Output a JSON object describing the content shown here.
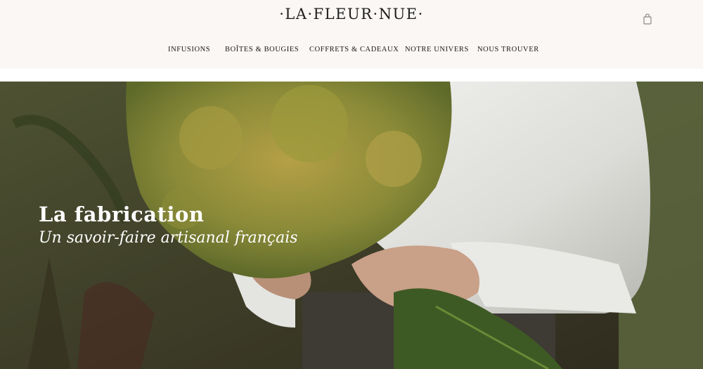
{
  "brand": {
    "logo": "·LA·FLEUR·NUE·"
  },
  "header": {
    "cart_icon": "shopping-bag-icon"
  },
  "nav": {
    "items": [
      {
        "label": "INFUSIONS"
      },
      {
        "label": "BOÎTES & BOUGIES"
      },
      {
        "label": "COFFRETS & CADEAUX"
      },
      {
        "label": "NOTRE UNIVERS"
      },
      {
        "label": "NOUS TROUVER"
      }
    ]
  },
  "hero": {
    "title": "La fabrication",
    "subtitle": "Un savoir-faire artisanal français"
  },
  "colors": {
    "header_bg": "#fbf7f4",
    "text": "#1a1a1a",
    "hero_text": "#ffffff"
  }
}
